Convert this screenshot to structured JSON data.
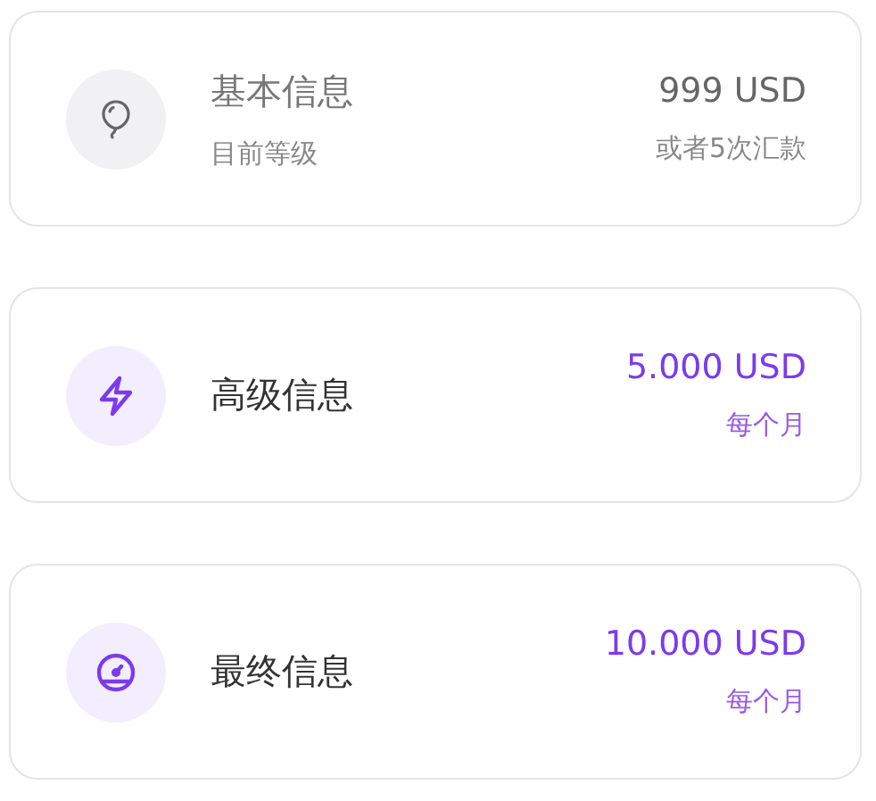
{
  "plans": [
    {
      "kind": "basic",
      "title": "基本信息",
      "subtitle": "目前等级",
      "price": "999 USD",
      "note": "或者5次汇款",
      "current": true
    },
    {
      "kind": "advanced",
      "title": "高级信息",
      "price": "5.000 USD",
      "note": "每个月",
      "current": false
    },
    {
      "kind": "ultimate",
      "title": "最终信息",
      "price": "10.000 USD",
      "note": "每个月",
      "current": false
    }
  ]
}
